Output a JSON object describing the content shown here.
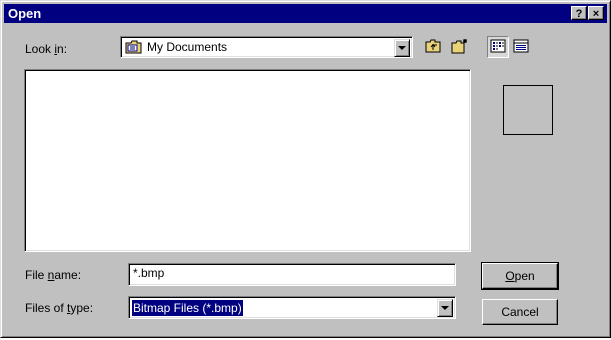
{
  "window": {
    "title": "Open",
    "help_label": "?",
    "close_label": "×"
  },
  "look_in": {
    "label_pre": "Look ",
    "label_mnemonic": "i",
    "label_post": "n:",
    "value": "My Documents"
  },
  "toolbar": {
    "buttons": [
      "up-one-level",
      "create-new-folder",
      "list-view",
      "details-view"
    ],
    "active_view": "list-view"
  },
  "file_name": {
    "label_pre": "File ",
    "label_mnemonic": "n",
    "label_post": "ame:",
    "value": "*.bmp"
  },
  "file_type": {
    "label_pre": "Files of ",
    "label_mnemonic": "t",
    "label_post": "ype:",
    "value": "Bitmap Files (*.bmp)"
  },
  "buttons": {
    "open_mnemonic": "O",
    "open_rest": "pen",
    "cancel": "Cancel"
  },
  "colors": {
    "title_bar": "#000080",
    "dialog_face": "#c0c0c0",
    "selection": "#000080"
  }
}
